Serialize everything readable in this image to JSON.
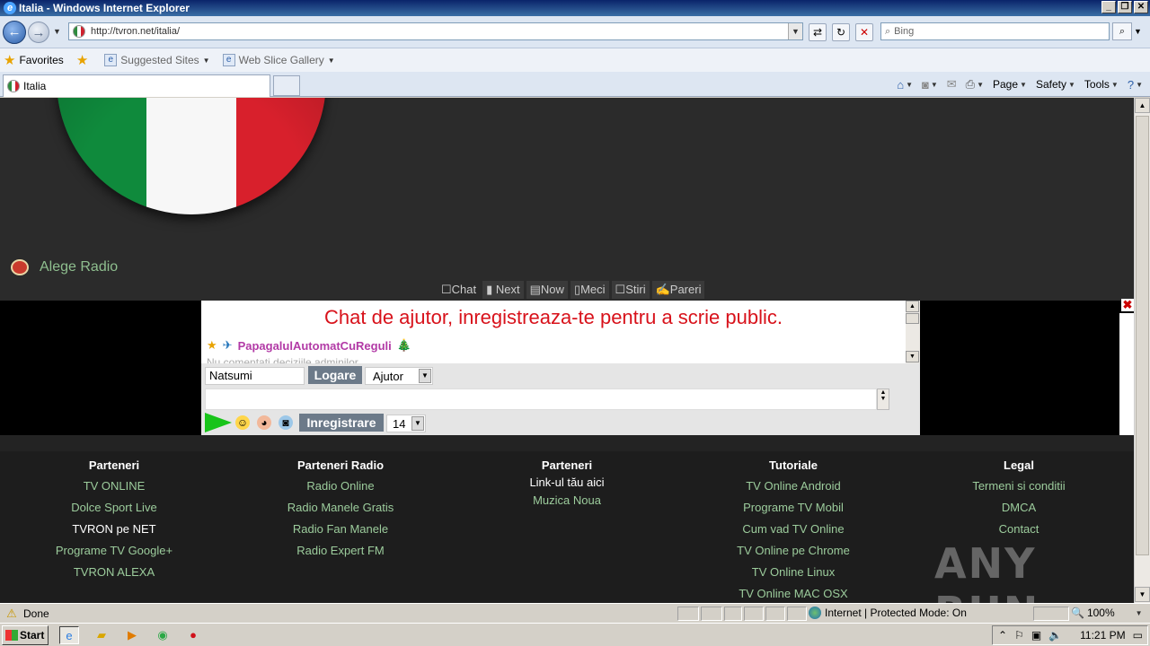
{
  "window": {
    "title": "Italia - Windows Internet Explorer"
  },
  "address": {
    "url": "http://tvron.net/italia/",
    "search_placeholder": "Bing"
  },
  "favorites": {
    "favorites_label": "Favorites",
    "suggested": "Suggested Sites",
    "slice": "Web Slice Gallery"
  },
  "tabs": {
    "active_title": "Italia"
  },
  "commands": {
    "page": "Page",
    "safety": "Safety",
    "tools": "Tools"
  },
  "page": {
    "radio_link": "Alege Radio",
    "chat_tabs": [
      "Chat",
      "Next",
      "Now",
      "Meci",
      "Stiri",
      "Pareri"
    ],
    "chat": {
      "title": "Chat de ajutor, inregistreaza-te pentru a scrie public.",
      "user_name": "PapagalulAutomatCuReguli",
      "admin_note": "Nu comentati deciziile adminilor.",
      "nick_value": "Natsumi",
      "login_label": "Logare",
      "help_select": "Ajutor",
      "register_label": "Inregistrare",
      "font_size": "14"
    },
    "footer": {
      "col1": {
        "title": "Parteneri",
        "links": [
          "TV ONLINE",
          "Dolce Sport Live",
          "TVRON pe NET",
          "Programe TV Google+",
          "TVRON ALEXA"
        ]
      },
      "col2": {
        "title": "Parteneri Radio",
        "links": [
          "Radio Online",
          "Radio Manele Gratis",
          "Radio Fan Manele",
          "Radio Expert FM"
        ]
      },
      "col3": {
        "title": "Parteneri",
        "subtitle": "Link-ul tău aici",
        "links": [
          "Muzica Noua"
        ]
      },
      "col4": {
        "title": "Tutoriale",
        "links": [
          "TV Online Android",
          "Programe TV Mobil",
          "Cum vad TV Online",
          "TV Online pe Chrome",
          "TV Online Linux",
          "TV Online MAC OSX"
        ]
      },
      "col5": {
        "title": "Legal",
        "links": [
          "Termeni si conditii",
          "DMCA",
          "Contact"
        ]
      }
    },
    "watermark": "ANY RUN"
  },
  "status": {
    "text": "Done",
    "zone": "Internet | Protected Mode: On",
    "zoom": "100%"
  },
  "taskbar": {
    "start": "Start",
    "clock": "11:21 PM"
  },
  "colors": {
    "chat_title": "#d8121b",
    "link_green": "#9ccc9c",
    "flag_green": "#0f8a3c",
    "flag_red": "#d8202c"
  }
}
